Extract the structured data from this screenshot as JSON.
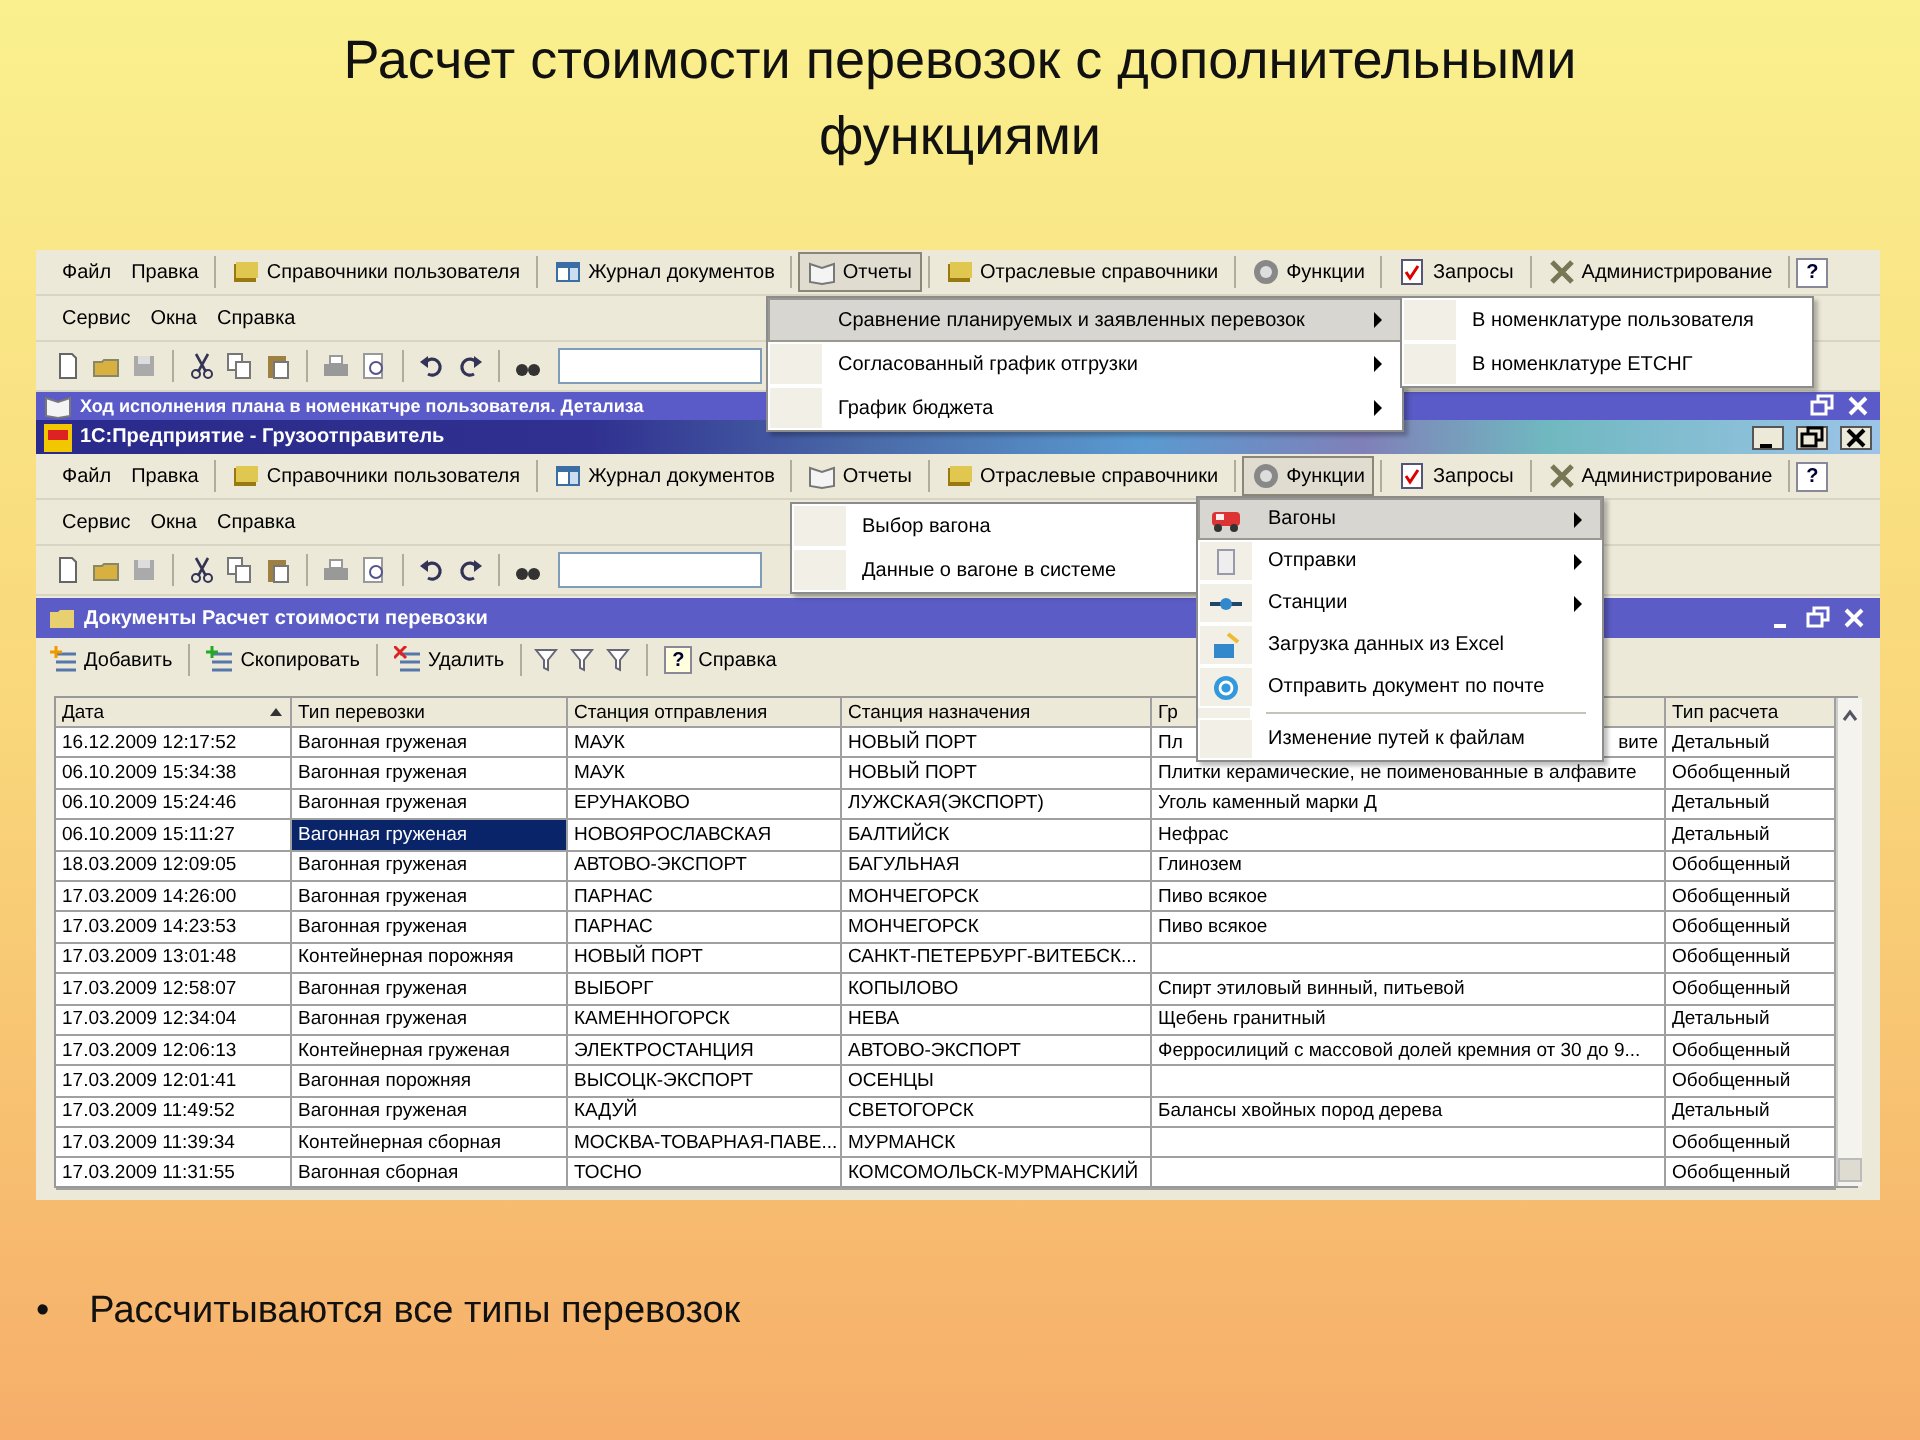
{
  "slide": {
    "title": "Расчет стоимости перевозок с дополнительными функциями",
    "bullet": {
      "marker": "•",
      "text": "Рассчитываются все типы перевозок"
    }
  },
  "back_window": {
    "menu_bar": [
      {
        "label": "Файл",
        "kind": "text",
        "pressed": false
      },
      {
        "label": "Правка",
        "kind": "text",
        "pressed": false
      },
      {
        "label": "Справочники пользователя",
        "kind": "tool",
        "pressed": false
      },
      {
        "label": "Журнал документов",
        "kind": "tool",
        "pressed": false
      },
      {
        "label": "Отчеты",
        "kind": "tool",
        "pressed": true
      },
      {
        "label": "Отраслевые справочники",
        "kind": "tool",
        "pressed": false
      },
      {
        "label": "Функции",
        "kind": "tool",
        "pressed": false
      },
      {
        "label": "Запросы",
        "kind": "tool",
        "pressed": false
      },
      {
        "label": "Администрирование",
        "kind": "tool",
        "pressed": false
      },
      {
        "label": "?",
        "kind": "help",
        "pressed": false
      }
    ],
    "menu_bar_2": [
      "Сервис",
      "Окна",
      "Справка"
    ],
    "document_title": "Ход исполнения плана в номенкатчре пользователя. Детализа",
    "open_menu": [
      {
        "label": "Сравнение планируемых и заявленных перевозок",
        "highlighted": true,
        "submenu": true
      },
      {
        "label": "Согласованный график отгрузки",
        "highlighted": false,
        "submenu": true
      },
      {
        "label": "График бюджета",
        "highlighted": false,
        "submenu": true
      }
    ],
    "submenu": [
      {
        "label": "В номенклатуре пользователя"
      },
      {
        "label": "В номенклатуре ЕТСНГ"
      }
    ]
  },
  "main_window": {
    "title": "1С:Предприятие - Грузоотправитель",
    "menu_bar": [
      {
        "label": "Файл",
        "kind": "text",
        "pressed": false
      },
      {
        "label": "Правка",
        "kind": "text",
        "pressed": false
      },
      {
        "label": "Справочники пользователя",
        "kind": "tool",
        "pressed": false
      },
      {
        "label": "Журнал документов",
        "kind": "tool",
        "pressed": false
      },
      {
        "label": "Отчеты",
        "kind": "tool",
        "pressed": false
      },
      {
        "label": "Отраслевые справочники",
        "kind": "tool",
        "pressed": false
      },
      {
        "label": "Функции",
        "kind": "tool",
        "pressed": true
      },
      {
        "label": "Запросы",
        "kind": "tool",
        "pressed": false
      },
      {
        "label": "Администрирование",
        "kind": "tool",
        "pressed": false
      },
      {
        "label": "?",
        "kind": "help",
        "pressed": false
      }
    ],
    "menu_bar_2": [
      "Сервис",
      "Окна",
      "Справка"
    ],
    "wagon_menu": [
      {
        "label": "Выбор вагона"
      },
      {
        "label": "Данные о вагоне в системе"
      }
    ],
    "functions_menu": [
      {
        "kind": "item",
        "label": "Вагоны",
        "highlighted": true,
        "submenu": true
      },
      {
        "kind": "item",
        "label": "Отправки",
        "highlighted": false,
        "submenu": true
      },
      {
        "kind": "item",
        "label": "Станции",
        "highlighted": false,
        "submenu": true
      },
      {
        "kind": "item",
        "label": "Загрузка данных из Excel",
        "highlighted": false,
        "submenu": false
      },
      {
        "kind": "item",
        "label": "Отправить документ по почте",
        "highlighted": false,
        "submenu": false
      },
      {
        "kind": "separator"
      },
      {
        "kind": "item",
        "label": "Изменение путей к файлам",
        "highlighted": false,
        "submenu": false
      }
    ]
  },
  "document_window": {
    "title": "Документы Расчет стоимости перевозки",
    "toolbar": [
      {
        "label": "Добавить"
      },
      {
        "label": "Скопировать"
      },
      {
        "label": "Удалить"
      },
      {
        "label": "Справка",
        "icon_text": "?"
      }
    ],
    "table": {
      "columns": [
        {
          "label": "Дата",
          "sorted": true
        },
        {
          "label": "Тип перевозки",
          "sorted": false
        },
        {
          "label": "Станция отправления",
          "sorted": false
        },
        {
          "label": "Станция назначения",
          "sorted": false
        },
        {
          "label": "Гр",
          "sorted": false
        },
        {
          "label": "Тип расчета",
          "sorted": false
        }
      ],
      "rows": [
        {
          "date": "16.12.2009 12:17:52",
          "type": "Вагонная груженая",
          "from": "МАУК",
          "to": "НОВЫЙ ПОРТ",
          "cargo_parts": [
            "Пл",
            "вите"
          ],
          "calc": "Детальный",
          "selected": false
        },
        {
          "date": "06.10.2009 15:34:38",
          "type": "Вагонная груженая",
          "from": "МАУК",
          "to": "НОВЫЙ ПОРТ",
          "cargo": "Плитки керамические, не поименованные в алфавите",
          "calc": "Обобщенный",
          "selected": false
        },
        {
          "date": "06.10.2009 15:24:46",
          "type": "Вагонная груженая",
          "from": "ЕРУНАКОВО",
          "to": "ЛУЖСКАЯ(ЭКСПОРТ)",
          "cargo": "Уголь каменный марки Д",
          "calc": "Детальный",
          "selected": false
        },
        {
          "date": "06.10.2009 15:11:27",
          "type": "Вагонная груженая",
          "from": "НОВОЯРОСЛАВСКАЯ",
          "to": "БАЛТИЙСК",
          "cargo": "Нефрас",
          "calc": "Детальный",
          "selected": true
        },
        {
          "date": "18.03.2009 12:09:05",
          "type": "Вагонная груженая",
          "from": "АВТОВО-ЭКСПОРТ",
          "to": "БАГУЛЬНАЯ",
          "cargo": "Глинозем",
          "calc": "Обобщенный",
          "selected": false
        },
        {
          "date": "17.03.2009 14:26:00",
          "type": "Вагонная груженая",
          "from": "ПАРНАС",
          "to": "МОНЧЕГОРСК",
          "cargo": "Пиво всякое",
          "calc": "Обобщенный",
          "selected": false
        },
        {
          "date": "17.03.2009 14:23:53",
          "type": "Вагонная груженая",
          "from": "ПАРНАС",
          "to": "МОНЧЕГОРСК",
          "cargo": "Пиво всякое",
          "calc": "Обобщенный",
          "selected": false
        },
        {
          "date": "17.03.2009 13:01:48",
          "type": "Контейнерная порожняя",
          "from": "НОВЫЙ ПОРТ",
          "to": "САНКТ-ПЕТЕРБУРГ-ВИТЕБСК...",
          "calc": "Обобщенный",
          "selected": false
        },
        {
          "date": "17.03.2009 12:58:07",
          "type": "Вагонная груженая",
          "from": "ВЫБОРГ",
          "to": "КОПЫЛОВО",
          "cargo": "Спирт этиловый винный, питьевой",
          "calc": "Обобщенный",
          "selected": false
        },
        {
          "date": "17.03.2009 12:34:04",
          "type": "Вагонная груженая",
          "from": "КАМЕННОГОРСК",
          "to": "НЕВА",
          "cargo": "Щебень гранитный",
          "calc": "Детальный",
          "selected": false
        },
        {
          "date": "17.03.2009 12:06:13",
          "type": "Контейнерная груженая",
          "from": "ЭЛЕКТРОСТАНЦИЯ",
          "to": "АВТОВО-ЭКСПОРТ",
          "cargo": "Ферросилиций с массовой долей кремния от 30 до 9...",
          "calc": "Обобщенный",
          "selected": false
        },
        {
          "date": "17.03.2009 12:01:41",
          "type": "Вагонная порожняя",
          "from": "ВЫСОЦК-ЭКСПОРТ",
          "to": "ОСЕНЦЫ",
          "calc": "Обобщенный",
          "selected": false
        },
        {
          "date": "17.03.2009 11:49:52",
          "type": "Вагонная груженая",
          "from": "КАДУЙ",
          "to": "СВЕТОГОРСК",
          "cargo": "Балансы хвойных пород дерева",
          "calc": "Детальный",
          "selected": false
        },
        {
          "date": "17.03.2009 11:39:34",
          "type": "Контейнерная сборная",
          "from": "МОСКВА-ТОВАРНАЯ-ПАВЕ...",
          "to": "МУРМАНСК",
          "calc": "Обобщенный",
          "selected": false
        },
        {
          "date": "17.03.2009 11:31:55",
          "type": "Вагонная сборная",
          "from": "ТОСНО",
          "to": "КОМСОМОЛЬСК-МУРМАНСКИЙ",
          "calc": "Обобщенный",
          "selected": false
        }
      ]
    }
  }
}
